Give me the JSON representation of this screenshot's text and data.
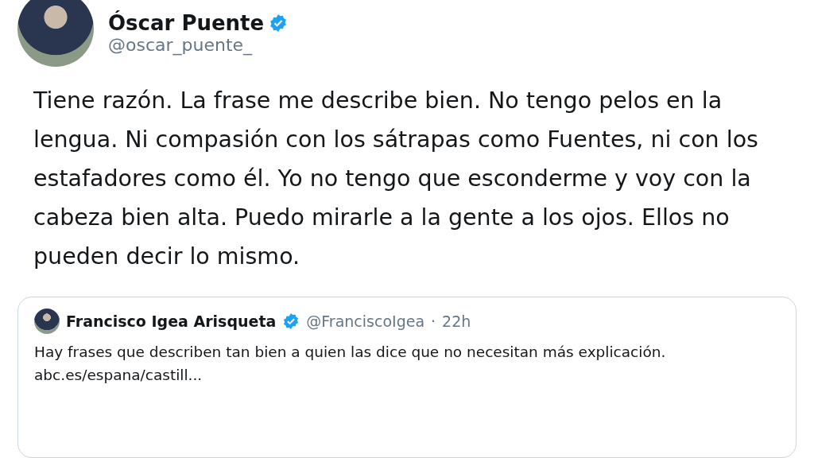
{
  "tweet": {
    "author_name": "Óscar Puente",
    "verified": true,
    "handle": "@oscar_puente_",
    "text": "Tiene razón. La frase me describe bien. No tengo pelos en la lengua. Ni compasión con los sátrapas como Fuentes, ni con los estafadores como él. Yo no tengo que esconderme y voy con la cabeza bien alta. Puedo mirarle a la gente a los ojos. Ellos no pueden decir lo mismo."
  },
  "quoted_tweet": {
    "author_name": "Francisco Igea Arisqueta",
    "verified": true,
    "handle": "@FranciscoIgea",
    "separator": "·",
    "time": "22h",
    "text": "Hay frases que describen tan bien a quien las dice que no necesitan más explicación.",
    "link": "abc.es/espana/castill..."
  }
}
